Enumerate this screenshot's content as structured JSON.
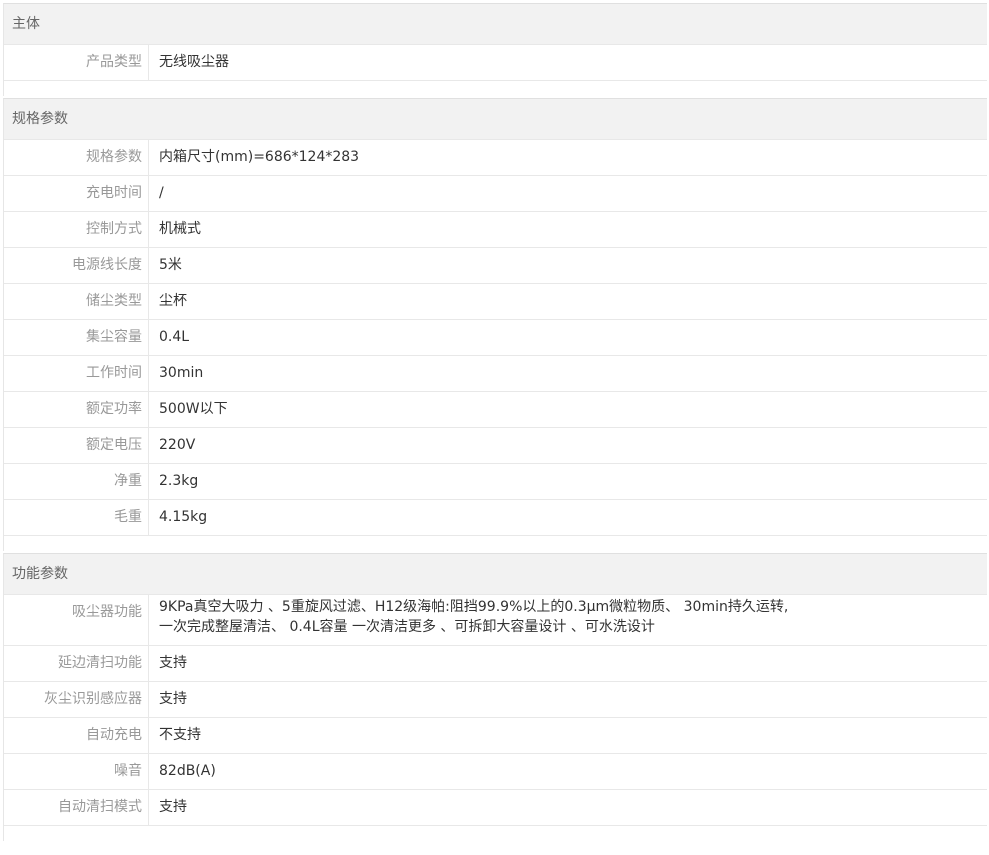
{
  "groups": [
    {
      "title": "主体",
      "rows": [
        {
          "k": "产品类型",
          "v": "无线吸尘器"
        }
      ]
    },
    {
      "title": "规格参数",
      "rows": [
        {
          "k": "规格参数",
          "v": "内箱尺寸(mm)=686*124*283"
        },
        {
          "k": "充电时间",
          "v": "/"
        },
        {
          "k": "控制方式",
          "v": "机械式"
        },
        {
          "k": "电源线长度",
          "v": "5米"
        },
        {
          "k": "储尘类型",
          "v": "尘杯"
        },
        {
          "k": "集尘容量",
          "v": "0.4L"
        },
        {
          "k": "工作时间",
          "v": "30min"
        },
        {
          "k": "额定功率",
          "v": "500W以下"
        },
        {
          "k": "额定电压",
          "v": "220V"
        },
        {
          "k": "净重",
          "v": "2.3kg"
        },
        {
          "k": "毛重",
          "v": "4.15kg"
        }
      ]
    },
    {
      "title": "功能参数",
      "rows": [
        {
          "k": "吸尘器功能",
          "v": "9KPa真空大吸力 、5重旋风过滤、H12级海帕:阻挡99.9%以上的0.3μm微粒物质、 30min持久运转,一次完成整屋清洁、 0.4L容量 一次清洁更多 、可拆卸大容量设计 、可水洗设计"
        },
        {
          "k": "延边清扫功能",
          "v": "支持"
        },
        {
          "k": "灰尘识别感应器",
          "v": "支持"
        },
        {
          "k": "自动充电",
          "v": "不支持"
        },
        {
          "k": "噪音",
          "v": "82dB(A)"
        },
        {
          "k": "自动清扫模式",
          "v": "支持"
        }
      ]
    }
  ]
}
